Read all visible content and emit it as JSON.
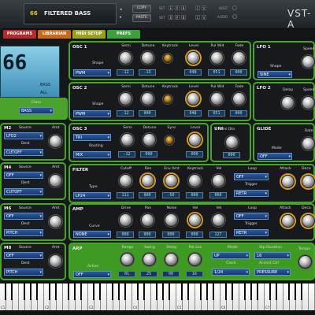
{
  "header": {
    "prog_number": "66",
    "prog_name": "FILTERED BASS",
    "copy": "COPY",
    "paste": "PASTE",
    "row1_label": "SET",
    "row2_label": "SET",
    "row1_keys": [
      "E",
      "P",
      "B"
    ],
    "row2_keys": [
      "E",
      "P",
      "B"
    ],
    "cv_keys": [
      "C",
      "V"
    ],
    "cv2_keys": [
      "C",
      "V"
    ],
    "host_label": "HOST",
    "audio_label": "AUDIO",
    "brand": "VST-A"
  },
  "tabs": [
    "PROGRAMS",
    "LIBRARIAN",
    "MIDI SETUP",
    "PREFS"
  ],
  "lcd": {
    "number": "66",
    "line1": "BASS",
    "line2": "ALL"
  },
  "class": {
    "label": "Class",
    "value": "BASS"
  },
  "osc1": {
    "title": "OSC 1",
    "shape_label": "Shape",
    "shape": "PWM",
    "knobs": [
      {
        "label": "Semi",
        "value": "-12"
      },
      {
        "label": "Detune",
        "value": "-13"
      },
      {
        "label": "Keytrack",
        "value": ""
      },
      {
        "label": "Level",
        "value": "048"
      },
      {
        "label": "Pul Wid",
        "value": "051"
      },
      {
        "label": "Fade",
        "value": "000"
      }
    ]
  },
  "osc2": {
    "title": "OSC 2",
    "shape_label": "Shape",
    "shape": "PWM",
    "knobs": [
      {
        "label": "Semi",
        "value": "-12"
      },
      {
        "label": "Detune",
        "value": "000"
      },
      {
        "label": "Keytrack",
        "value": ""
      },
      {
        "label": "Level",
        "value": "048"
      },
      {
        "label": "Pul Wid",
        "value": "051"
      },
      {
        "label": "Fade",
        "value": "000"
      }
    ]
  },
  "osc3": {
    "title": "OSC 3",
    "shape_label": "Shape",
    "shape": "TRI",
    "routing_label": "Routing",
    "routing": "MIX",
    "knobs": [
      {
        "label": "Semi",
        "value": "-12"
      },
      {
        "label": "Detune",
        "value": "000"
      },
      {
        "label": "Sync",
        "value": ""
      },
      {
        "label": "Level",
        "value": "000"
      }
    ]
  },
  "lfo1": {
    "title": "LFO 1",
    "shape_label": "Shape",
    "shape": "SINE",
    "speed_label": "Speed"
  },
  "lfo2": {
    "title": "LFO 2",
    "delay_label": "Delay",
    "speed_label": "Speed"
  },
  "uni": {
    "title": "UNI",
    "dtn_label": "Uni Dtn",
    "dtn_value": "000"
  },
  "glide": {
    "title": "GLIDE",
    "mode_label": "Mode",
    "mode": "OFF",
    "rate_label": "Rate"
  },
  "filter": {
    "title": "FILTER",
    "type_label": "Type",
    "type": "LP24",
    "knobs": [
      {
        "label": "Cutoff",
        "value": "111"
      },
      {
        "label": "Res",
        "value": "000"
      },
      {
        "label": "Env Amt",
        "value": "-50"
      },
      {
        "label": "Keytrack",
        "value": "000"
      },
      {
        "label": "Vel",
        "value": "000"
      }
    ],
    "loop_label": "Loop",
    "loop": "OFF",
    "trigger_label": "Trigger",
    "trigger": "RETR",
    "attack_label": "Attack",
    "decay_label": "Deca"
  },
  "amp": {
    "title": "AMP",
    "curve_label": "Curve",
    "curve": "NONE",
    "knobs": [
      {
        "label": "Drive",
        "value": "000"
      },
      {
        "label": "Pan",
        "value": "000"
      },
      {
        "label": "Noise",
        "value": "000"
      },
      {
        "label": "Vel",
        "value": "000"
      },
      {
        "label": "Vel",
        "value": "127"
      }
    ],
    "loop_label": "Loop",
    "loop": "OFF",
    "trigger_label": "Trigger",
    "trigger": "RETR",
    "attack_label": "Attack",
    "decay_label": "Deca"
  },
  "arp": {
    "title": "ARP",
    "active_label": "Active",
    "active": "OFF",
    "knobs": [
      {
        "label": "Range",
        "value": "01"
      },
      {
        "label": "Swing",
        "value": "25"
      },
      {
        "label": "Delay",
        "value": "00"
      },
      {
        "label": "Pat Len",
        "value": "16"
      }
    ],
    "mode_label": "Mode",
    "mode": "UP",
    "step_label": "Stp Duration",
    "step": "16",
    "clock_label": "Clock",
    "clock": "1/24",
    "accent_label": "Accent Ctrl",
    "accent": "PRESSURE",
    "tempo_label": "Tempo"
  },
  "mods": [
    {
      "title": "M2",
      "source": "LFO2",
      "dest": "CUTOFF"
    },
    {
      "title": "M4",
      "source": "OFF",
      "dest": "CUTOFF"
    },
    {
      "title": "M6",
      "source": "OFF",
      "dest": "PITCH"
    },
    {
      "title": "M8",
      "source": "OFF",
      "dest": "PITCH"
    }
  ],
  "mod_labels": {
    "source": "Source",
    "dest": "Dest",
    "amt": "Amt"
  },
  "keyboard": {
    "labels": [
      "C1",
      "C2",
      "C3",
      "C4",
      "C5",
      "C6",
      "C7"
    ]
  },
  "colors": {
    "accent_green": "#4aa32a",
    "lcd": "#6fb8d8",
    "tab_programs": "#b8282c",
    "tab_librarian": "#c86a1a",
    "tab_midi": "#9aa21a",
    "tab_prefs": "#3aa23a"
  }
}
